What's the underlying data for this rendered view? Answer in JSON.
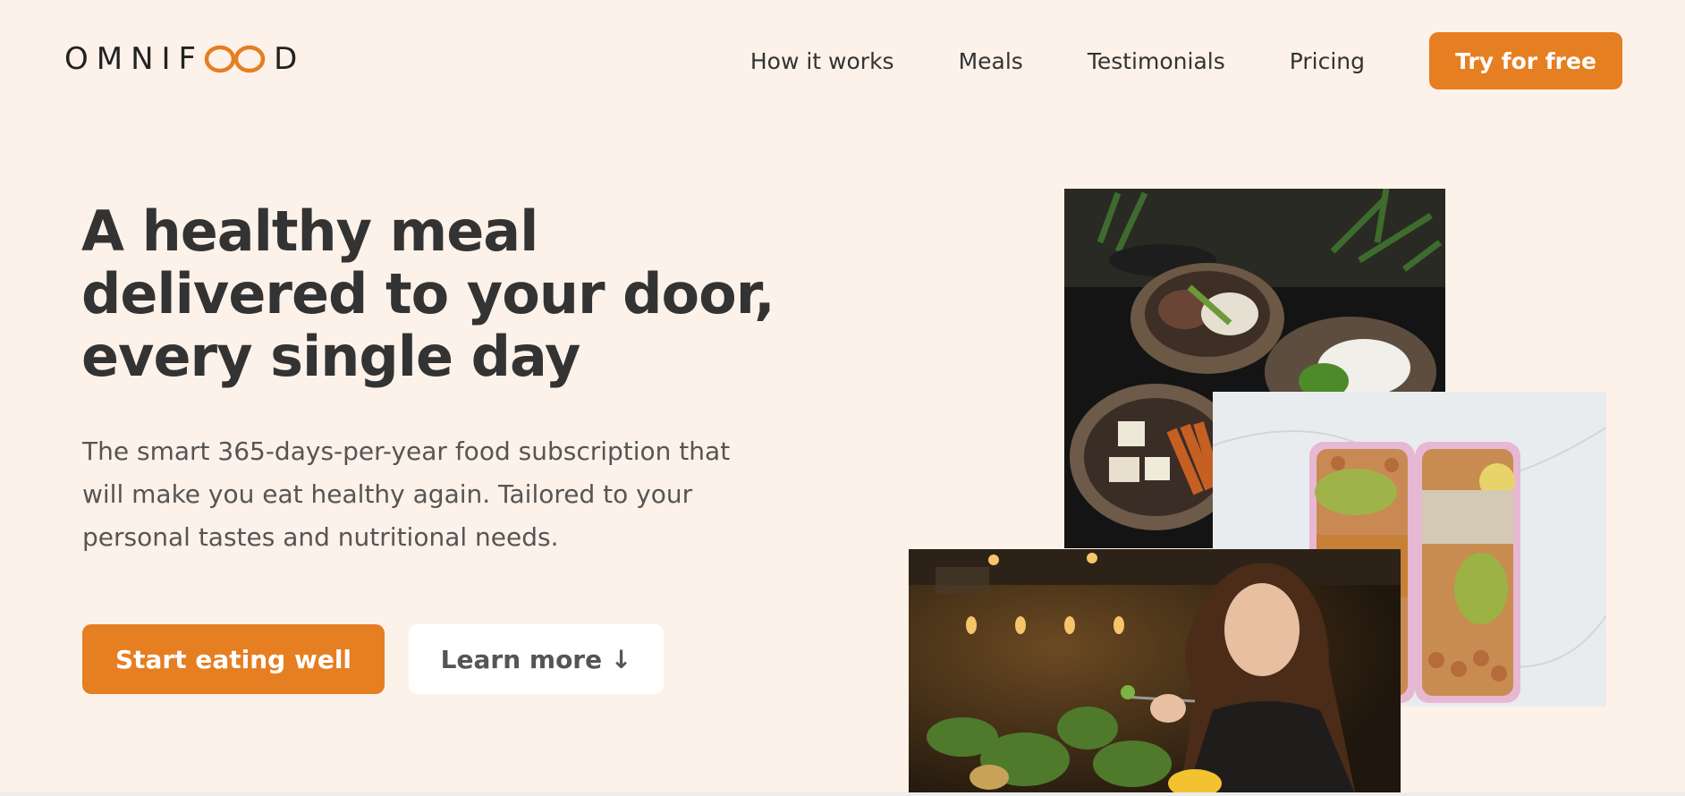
{
  "header": {
    "logo": {
      "prefix": "OMNIF",
      "suffix": "D"
    },
    "nav": [
      {
        "label": "How it works"
      },
      {
        "label": "Meals"
      },
      {
        "label": "Testimonials"
      },
      {
        "label": "Pricing"
      }
    ],
    "cta": "Try for free"
  },
  "hero": {
    "headline": "A healthy meal delivered to your door, every single day",
    "description": "The smart 365-days-per-year food subscription that will make you eat healthy again. Tailored to your personal tastes and nutritional needs.",
    "primary_button": "Start eating well",
    "secondary_button": "Learn more ↓"
  },
  "colors": {
    "background": "#fdf2e9",
    "accent": "#e67e22",
    "text": "#333333"
  }
}
